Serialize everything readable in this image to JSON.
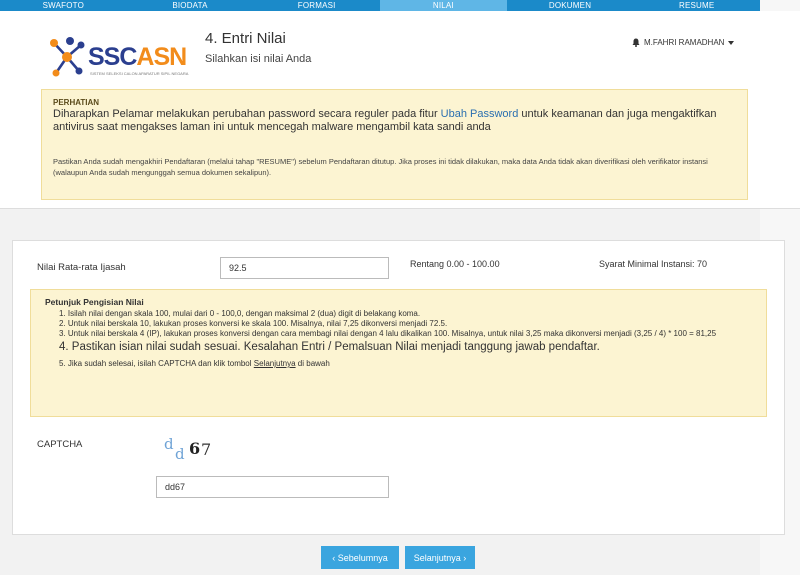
{
  "nav": {
    "tabs": [
      {
        "label": "SWAFOTO"
      },
      {
        "label": "BIODATA"
      },
      {
        "label": "FORMASI"
      },
      {
        "label": "NILAI"
      },
      {
        "label": "DOKUMEN"
      },
      {
        "label": "RESUME"
      }
    ],
    "active_index": 3
  },
  "logo": {
    "brand_a": "SSC",
    "brand_b": "ASN",
    "tagline": "SISTEM SELEKSI CALON APARATUR SIPIL NEGARA"
  },
  "header": {
    "title": "4. Entri Nilai",
    "subtitle": "Silahkan isi nilai Anda",
    "user_name": "M.FAHRI RAMADHAN"
  },
  "alert": {
    "heading": "PERHATIAN",
    "text_before": "Diharapkan Pelamar melakukan perubahan password secara reguler pada fitur ",
    "link": "Ubah Password",
    "text_after": " untuk keamanan dan juga mengaktifkan antivirus saat mengakses laman ini untuk mencegah malware mengambil kata sandi anda",
    "note": "Pastikan Anda sudah mengakhiri Pendaftaran (melalui tahap \"RESUME\") sebelum Pendaftaran ditutup. Jika proses ini tidak dilakukan, maka data Anda tidak akan diverifikasi oleh verifikator instansi (walaupun Anda sudah mengunggah semua dokumen sekalipun)."
  },
  "form": {
    "nilai_label": "Nilai Rata-rata Ijasah",
    "nilai_value": "92.5",
    "rentang": "Rentang 0.00 - 100.00",
    "syarat": "Syarat Minimal Instansi: 70",
    "petunjuk_heading": "Petunjuk Pengisian Nilai",
    "petunjuk": [
      "1. Isilah nilai dengan skala 100, mulai dari 0 - 100,0, dengan maksimal 2 (dua) digit di belakang koma.",
      "2. Untuk nilai berskala 10, lakukan proses konversi ke skala 100. Misalnya, nilai 7,25 dikonversi menjadi 72.5.",
      "3. Untuk nilai berskala 4 (IP), lakukan proses konversi dengan cara membagi nilai dengan 4 lalu dikalikan 100. Misalnya, untuk nilai 3,25 maka dikonversi menjadi (3,25 / 4) * 100 = 81,25",
      "4. Pastikan isian nilai sudah sesuai. Kesalahan Entri / Pemalsuan Nilai menjadi tanggung jawab pendaftar."
    ],
    "petunjuk5_before": "5. Jika sudah selesai, isilah CAPTCHA dan klik tombol ",
    "petunjuk5_link": "Selanjutnya",
    "petunjuk5_after": " di bawah",
    "captcha_label": "CAPTCHA",
    "captcha_chars": [
      "d",
      "d",
      "6",
      "7"
    ],
    "captcha_value": "dd67"
  },
  "buttons": {
    "prev": "‹ Sebelumnya",
    "next": "Selanjutnya ›"
  },
  "colors": {
    "nav": "#1b8ac9",
    "nav_active": "#5fb6e6",
    "alert_bg": "#fcf4d2",
    "button": "#3aa5df",
    "logo_blue": "#2b3f8f",
    "logo_orange": "#f28c1b"
  }
}
